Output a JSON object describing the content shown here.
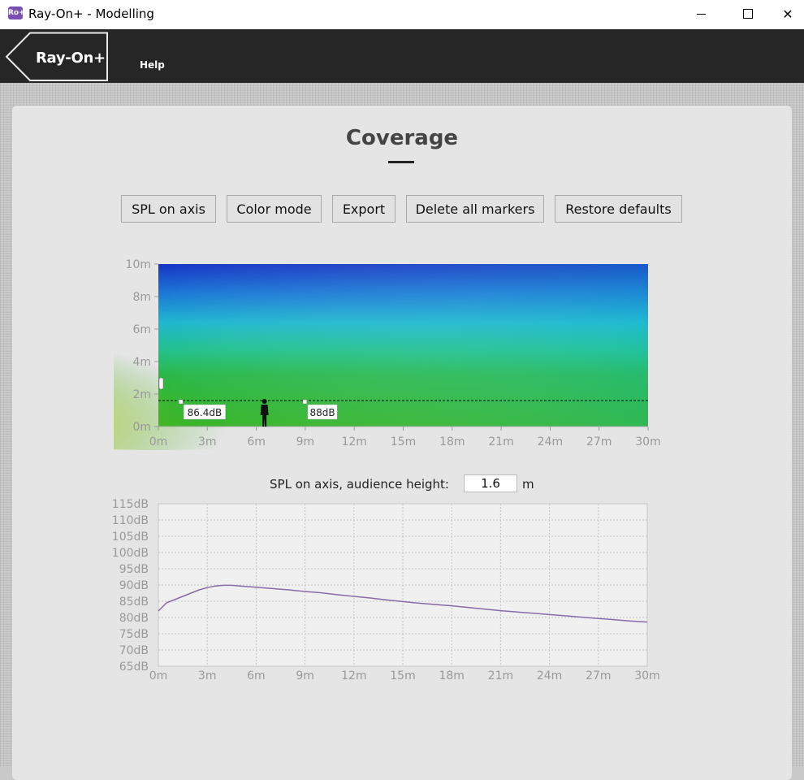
{
  "window": {
    "icon_text": "Ro+",
    "title": "Ray-On+ - Modelling",
    "close_glyph": "✕"
  },
  "appbar": {
    "back_label": "Ray-On+",
    "help_label": "Help"
  },
  "page": {
    "title": "Coverage"
  },
  "toolbar": {
    "buttons": [
      {
        "label": "SPL on axis"
      },
      {
        "label": "Color mode"
      },
      {
        "label": "Export"
      },
      {
        "label": "Delete all markers"
      },
      {
        "label": "Restore defaults"
      }
    ]
  },
  "coverage_map": {
    "y_ticks": [
      "10m",
      "8m",
      "6m",
      "4m",
      "2m",
      "0m"
    ],
    "x_ticks": [
      "0m",
      "3m",
      "6m",
      "9m",
      "12m",
      "15m",
      "18m",
      "21m",
      "24m",
      "27m",
      "30m"
    ],
    "audience_height_m": 1.6,
    "markers": [
      {
        "x_m": 1.4,
        "label": "86.4dB"
      },
      {
        "x_m": 9.0,
        "label": "88dB"
      }
    ],
    "listener_x_m": 6.5,
    "speaker_height_m": 2.7
  },
  "spl": {
    "label": "SPL on axis, audience height:",
    "height_value": "1.6",
    "unit": "m"
  },
  "chart_data": {
    "type": "line",
    "title": "",
    "xlabel": "",
    "ylabel": "",
    "xlim": [
      0,
      30
    ],
    "ylim": [
      65,
      115
    ],
    "x_ticks": [
      "0m",
      "3m",
      "6m",
      "9m",
      "12m",
      "15m",
      "18m",
      "21m",
      "24m",
      "27m",
      "30m"
    ],
    "y_ticks": [
      "115dB",
      "110dB",
      "105dB",
      "100dB",
      "95dB",
      "90dB",
      "85dB",
      "80dB",
      "75dB",
      "70dB",
      "65dB"
    ],
    "grid": true,
    "line_color": "#8a6aa8",
    "series": [
      {
        "x": [
          0,
          0.5,
          1,
          1.5,
          2,
          2.5,
          3,
          3.5,
          4,
          4.5,
          5,
          6,
          7,
          8,
          9,
          10,
          11,
          12,
          13,
          14,
          15,
          16,
          17,
          18,
          19,
          20,
          21,
          22,
          23,
          24,
          25,
          26,
          27,
          28,
          29,
          30
        ],
        "y": [
          82,
          84.5,
          85.5,
          86.5,
          87.5,
          88.5,
          89.2,
          89.7,
          89.9,
          89.9,
          89.7,
          89.3,
          88.9,
          88.5,
          88.0,
          87.6,
          87.0,
          86.5,
          86.0,
          85.4,
          84.9,
          84.4,
          84.0,
          83.6,
          83.1,
          82.6,
          82.1,
          81.7,
          81.3,
          80.9,
          80.5,
          80.1,
          79.7,
          79.3,
          78.9,
          78.6
        ]
      }
    ]
  }
}
